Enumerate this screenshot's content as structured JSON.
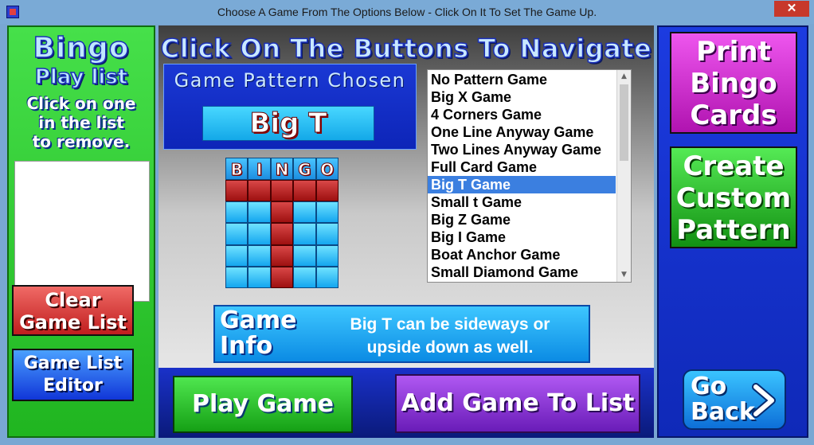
{
  "window": {
    "title": "Choose A Game From The Options Below - Click On It To Set The Game  Up.",
    "close_glyph": "✕"
  },
  "left_panel": {
    "title_line1": "Bingo",
    "title_line2": "Play list",
    "instruction_lines": [
      "Click on one",
      "in the list",
      "to remove."
    ],
    "clear_button_lines": [
      "Clear",
      "Game List"
    ],
    "editor_button_lines": [
      "Game List",
      "Editor"
    ]
  },
  "center": {
    "heading": "Click On The Buttons To Navigate",
    "pattern_label": "Game Pattern Chosen",
    "pattern_value": "Big T",
    "grid_letters": [
      "B",
      "I",
      "N",
      "G",
      "O"
    ],
    "grid_marked": [
      [
        1,
        1,
        1,
        1,
        1
      ],
      [
        0,
        0,
        1,
        0,
        0
      ],
      [
        0,
        0,
        1,
        0,
        0
      ],
      [
        0,
        0,
        1,
        0,
        0
      ],
      [
        0,
        0,
        1,
        0,
        0
      ]
    ],
    "games": [
      "No Pattern Game",
      "Big X Game",
      "4 Corners Game",
      "One Line Anyway Game",
      "Two Lines Anyway Game",
      "Full Card Game",
      "Big T Game",
      "Small t Game",
      "Big Z Game",
      "Big I Game",
      "Boat Anchor Game",
      "Small Diamond Game"
    ],
    "selected_game": "Big T Game",
    "info_label_lines": [
      "Game",
      "Info"
    ],
    "info_text_lines": [
      "Big T can be sideways or",
      "upside down as well."
    ],
    "play_button": "Play Game",
    "add_button": "Add Game To List"
  },
  "right_panel": {
    "print_button_lines": [
      "Print",
      "Bingo",
      "Cards"
    ],
    "create_button_lines": [
      "Create",
      "Custom",
      "Pattern"
    ],
    "back_button_lines": [
      "Go",
      "Back"
    ]
  },
  "colors": {
    "left_panel": "#2fcf2f",
    "right_panel": "#1c3be0",
    "marked_cell": "#b82020",
    "unmarked_cell": "#2ab8f5",
    "selection": "#3b7fe0"
  }
}
